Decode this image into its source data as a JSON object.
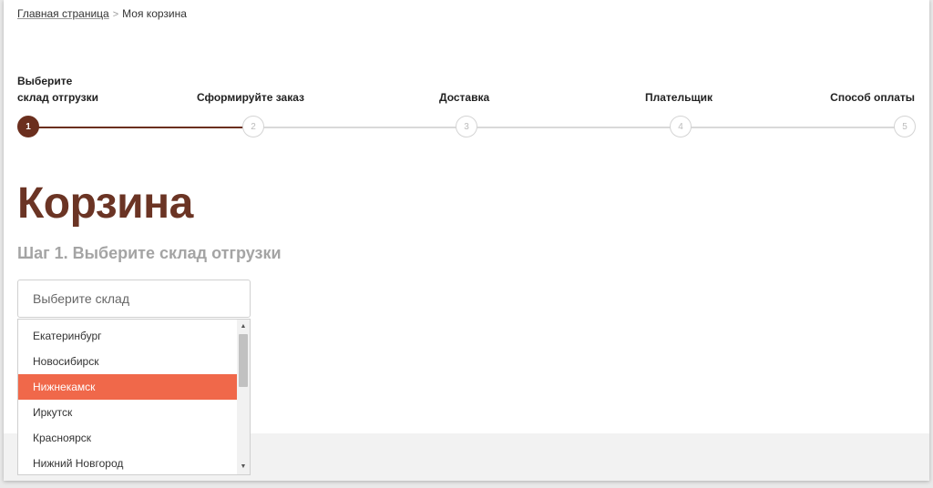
{
  "breadcrumb": {
    "home": "Главная страница",
    "separator": ">",
    "current": "Моя корзина"
  },
  "steps": [
    {
      "line1": "Выберите",
      "line2": "склад отгрузки",
      "number": "1",
      "active": true
    },
    {
      "line1": "",
      "line2": "Сформируйте заказ",
      "number": "2",
      "active": false
    },
    {
      "line1": "",
      "line2": "Доставка",
      "number": "3",
      "active": false
    },
    {
      "line1": "",
      "line2": "Плательщик",
      "number": "4",
      "active": false
    },
    {
      "line1": "",
      "line2": "Способ оплаты",
      "number": "5",
      "active": false
    }
  ],
  "page": {
    "title": "Корзина",
    "step_heading": "Шаг 1. Выберите склад отгрузки"
  },
  "warehouse_select": {
    "placeholder": "Выберите склад",
    "options": [
      "Екатеринбург",
      "Новосибирск",
      "Нижнекамск",
      "Иркутск",
      "Красноярск",
      "Нижний Новгород"
    ],
    "highlighted": "Нижнекамск"
  },
  "icons": {
    "scroll_up": "scroll-up-arrow-icon",
    "scroll_down": "scroll-down-arrow-icon"
  },
  "colors": {
    "brand_brown": "#6b3424",
    "highlight": "#f0684a",
    "muted": "#a4a4a4"
  }
}
